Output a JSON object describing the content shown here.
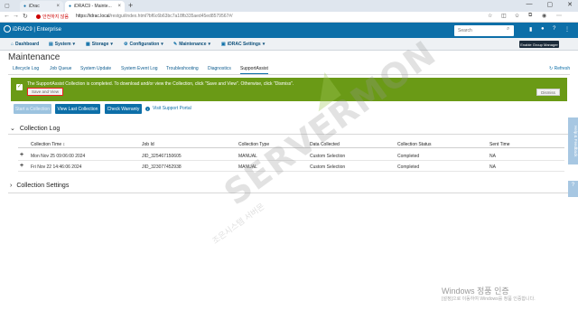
{
  "browser": {
    "tabs": [
      {
        "label": "iDrac"
      },
      {
        "label": "iDRAC9 - Mainte..."
      }
    ],
    "security_label": "안전하지 않음",
    "url_host": "https://idrac.local",
    "url_path": "/restgui/index.html?bf6c6b63bc7a18fb335aed45ed8579567#/"
  },
  "header": {
    "brand": "iDRAC9 | Enterprise",
    "search_placeholder": "Search",
    "enable_group_manager": "Enable Group Manager"
  },
  "menu": {
    "dashboard": "Dashboard",
    "system": "System",
    "storage": "Storage",
    "configuration": "Configuration",
    "maintenance": "Maintenance",
    "idrac_settings": "iDRAC Settings"
  },
  "page": {
    "title": "Maintenance",
    "refresh": "Refresh",
    "subtabs": [
      "Lifecycle Log",
      "Job Queue",
      "System Update",
      "System Event Log",
      "Troubleshooting",
      "Diagnostics",
      "SupportAssist"
    ]
  },
  "notice": {
    "message": "The SupportAssist Collection is completed. To download and/or view the Collection, click \"Save and View\". Otherwise, click \"Dismiss\".",
    "save_view": "Save and View",
    "dismiss": "Dismiss"
  },
  "actions": {
    "start_collection": "Start a Collection",
    "view_last": "View Last Collection",
    "check_warranty": "Check Warranty",
    "visit_portal": "Visit Support Portal"
  },
  "collection_log": {
    "title": "Collection Log",
    "columns": [
      "Collection Time",
      "Job Id",
      "Collection Type",
      "Data Collected",
      "Collection Status",
      "Sent Time"
    ],
    "rows": [
      [
        "Mon Nov 25 09:06:00 2024",
        "JID_325467150605",
        "MANUAL",
        "Custom Selection",
        "Completed",
        "NA"
      ],
      [
        "Fri Nov 22 14:46:06 2024",
        "JID_323077452938",
        "MANUAL",
        "Custom Selection",
        "Completed",
        "NA"
      ]
    ]
  },
  "collection_settings": {
    "title": "Collection Settings"
  },
  "side": {
    "help": "Help & Feedback",
    "qmark": "?"
  },
  "windows": {
    "line1": "Windows 정품 인증",
    "line2": "[설정]으로 이동하여 Windows를 정품 인증합니다."
  },
  "watermark": {
    "main": "SERVERMON",
    "sub": "조은시스템 서버몬"
  }
}
